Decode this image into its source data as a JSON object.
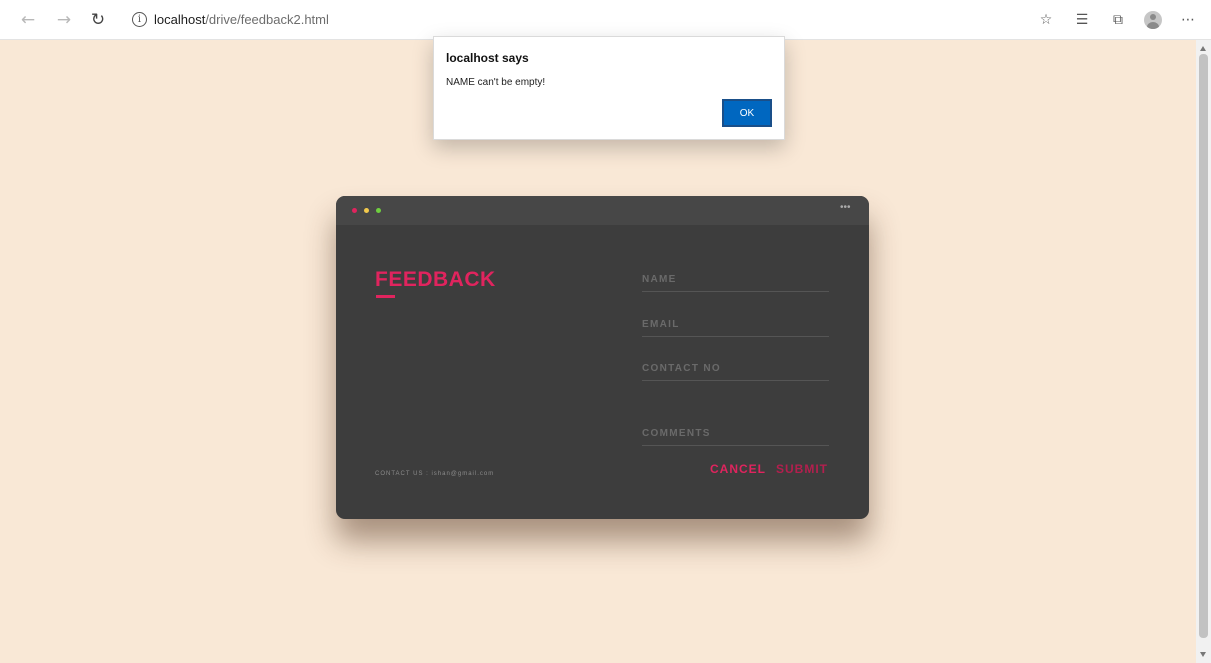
{
  "browser": {
    "url_host": "localhost",
    "url_path": "/drive/feedback2.html"
  },
  "alert": {
    "title": "localhost says",
    "message": "NAME can't be empty!",
    "ok_label": "OK"
  },
  "form": {
    "title": "FEEDBACK",
    "name_placeholder": "NAME",
    "email_placeholder": "EMAIL",
    "contact_placeholder": "CONTACT NO",
    "comments_placeholder": "COMMENTS",
    "cancel_label": "CANCEL",
    "submit_label": "SUBMIT",
    "contact_info": "CONTACT US : ishan@gmail.com",
    "more_label": "•••"
  },
  "colors": {
    "accent": "#e0245e",
    "page_background": "#f9e8d6",
    "card_background": "#3d3d3d"
  }
}
